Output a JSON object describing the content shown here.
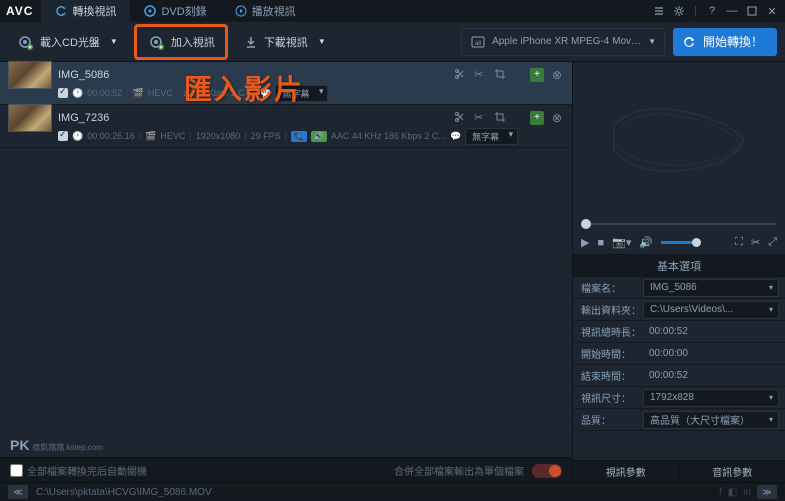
{
  "app_name": "AVC",
  "tabs": {
    "convert": "轉換視訊",
    "dvd": "DVD刻錄",
    "play": "播放視訊"
  },
  "toolbar": {
    "load_cd": "載入CD光盤",
    "add_video": "加入視訊",
    "download": "下載視訊",
    "profile": "Apple iPhone XR MPEG-4 Movie (*.m...",
    "convert": "開始轉換！"
  },
  "annotation": "匯入影片",
  "files": [
    {
      "name": "IMG_5086",
      "duration": "00:00:52",
      "codec": "HEVC",
      "info": "z 178 Kbps 2 C...",
      "subtitle": "無字幕",
      "selected": true
    },
    {
      "name": "IMG_7236",
      "duration": "00:00:26.16",
      "codec": "HEVC",
      "res": "1920x1080",
      "fps": "29 FPS",
      "audio": "AAC 44 KHz 186 Kbps 2 C...",
      "subtitle": "無字幕",
      "selected": false
    }
  ],
  "pk_brand": "PK",
  "pk_sub": "痞凱踏踏\nkstep.com",
  "merge": {
    "checkbox_label": "全部檔案轉換完后自動關機",
    "right_label": "合併全部檔案輸出為單個檔案"
  },
  "opts": {
    "header": "基本選項",
    "filename_l": "檔案名：",
    "filename_v": "IMG_5086",
    "outdir_l": "輸出資料夾：",
    "outdir_v": "C:\\Users\\Videos\\...",
    "vdur_l": "視訊總時長：",
    "vdur_v": "00:00:52",
    "start_l": "開始時間：",
    "start_v": "00:00:00",
    "end_l": "結束時間：",
    "end_v": "00:00:52",
    "size_l": "視訊尺寸：",
    "size_v": "1792x828",
    "quality_l": "品質：",
    "quality_v": "高品質（大尺寸檔案）",
    "video_params": "視訊參數",
    "audio_params": "音訊參數"
  },
  "statusbar": {
    "path": "C:\\Users\\pktata\\HCVG\\IMG_5086.MOV"
  }
}
